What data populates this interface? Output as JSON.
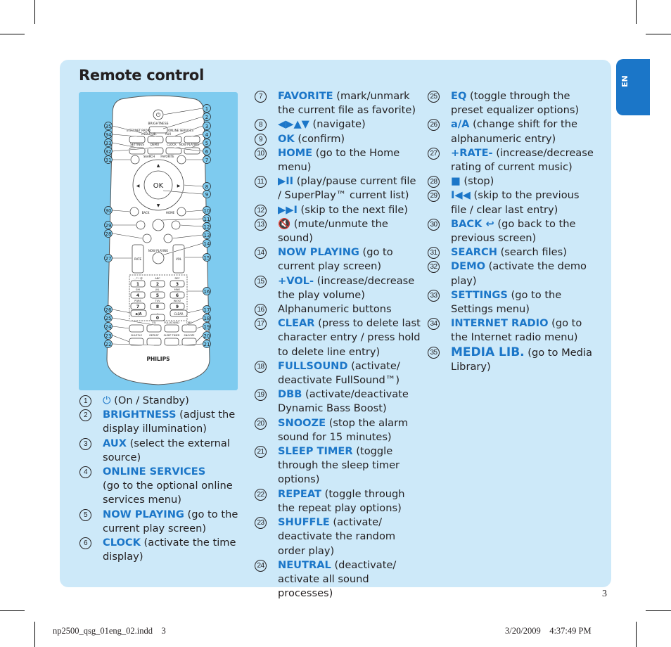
{
  "page": {
    "title": "Remote control",
    "language_tab": "EN",
    "page_number": "3",
    "slug_left": "np2500_qsg_01eng_02.indd    3",
    "slug_right": "3/20/2009    4:37:49 PM"
  },
  "colors": {
    "accent_blue": "#1b76c8",
    "panel_bg": "#cde9f9",
    "remote_bg": "#7ecbef"
  },
  "remote": {
    "brand": "PHILIPS",
    "ok_label": "OK",
    "button_labels": {
      "brightness": "BRIGHTNESS",
      "internet_radio": "INTERNET RADIO",
      "media_lib": "MEDIA LIB.",
      "aux": "AUX",
      "online_services": "ONLINE SERVICES",
      "settings": "SETTINGS",
      "demo": "DEMO",
      "clock": "CLOCK",
      "now_playing": "NOW PLAYING",
      "search": "SEARCH",
      "favorite": "FAVORITE",
      "back": "BACK",
      "home": "HOME",
      "rate": "RATE",
      "vol": "VOL",
      "now_playing_center": "NOW PLAYING",
      "a_a": "a/A",
      "clear": "CLEAR",
      "eq": "EQ",
      "fullsound": "FULLSOUND",
      "dbb": "DBB",
      "shuffle": "SHUFFLE",
      "repeat": "REPEAT",
      "sleep_timer": "SLEEP TIMER",
      "snooze": "SNOOZE",
      "neutral": "NEUTRAL"
    },
    "keypad": [
      {
        "digit": "1",
        "letters": ". , ? ! @"
      },
      {
        "digit": "2",
        "letters": "ABC"
      },
      {
        "digit": "3",
        "letters": "DEF"
      },
      {
        "digit": "4",
        "letters": "GHI"
      },
      {
        "digit": "5",
        "letters": "JKL"
      },
      {
        "digit": "6",
        "letters": "MNO"
      },
      {
        "digit": "7",
        "letters": "PQRS"
      },
      {
        "digit": "8",
        "letters": "TUV"
      },
      {
        "digit": "9",
        "letters": "WXYZ"
      },
      {
        "digit": "0",
        "letters": "_"
      }
    ],
    "callouts_right": [
      "1",
      "2",
      "3",
      "4",
      "5",
      "6",
      "7",
      "8",
      "9",
      "10",
      "11",
      "12",
      "13",
      "14",
      "15",
      "16",
      "17",
      "18",
      "19",
      "20",
      "21"
    ],
    "callouts_left": [
      "35",
      "34",
      "33",
      "32",
      "31",
      "30",
      "29",
      "28",
      "27",
      "26",
      "25",
      "24",
      "23",
      "22"
    ]
  },
  "legend": {
    "column1": [
      {
        "num": "1",
        "icon": "⏻",
        "key": "",
        "desc": " (On / Standby)"
      },
      {
        "num": "2",
        "key": "BRIGHTNESS",
        "desc": " (adjust the display illumination)"
      },
      {
        "num": "3",
        "key": "AUX",
        "desc": " (select the external source)"
      },
      {
        "num": "4",
        "key": "ONLINE SERVICES",
        "desc": "(go to the optional online services menu)"
      },
      {
        "num": "5",
        "key": "NOW PLAYING",
        "desc": " (go to the current play screen)"
      },
      {
        "num": "6",
        "key": "CLOCK",
        "desc": " (activate the time display)"
      }
    ],
    "column2": [
      {
        "num": "7",
        "key": "FAVORITE",
        "desc": " (mark/unmark the current file as favorite)"
      },
      {
        "num": "8",
        "key": "◀▶▲▼",
        "desc": " (navigate)"
      },
      {
        "num": "9",
        "key": "OK",
        "desc": " (confirm)"
      },
      {
        "num": "10",
        "key": "HOME",
        "desc": " (go to the Home menu)"
      },
      {
        "num": "11",
        "key": "▶II",
        "desc": " (play/pause current file / SuperPlay™ current list)"
      },
      {
        "num": "12",
        "key": "▶▶I",
        "desc": " (skip to the next file)"
      },
      {
        "num": "13",
        "key": "🔇",
        "desc": " (mute/unmute the sound)"
      },
      {
        "num": "14",
        "key": "NOW PLAYING",
        "desc": " (go to current play screen)"
      },
      {
        "num": "15",
        "key": "+VOL-",
        "desc": " (increase/decrease the play volume)"
      },
      {
        "num": "16",
        "key": "",
        "desc": "Alphanumeric buttons"
      },
      {
        "num": "17",
        "key": "CLEAR",
        "desc": " (press to delete last character entry / press hold to delete line entry)"
      },
      {
        "num": "18",
        "key": "FULLSOUND",
        "desc": " (activate/ deactivate FullSound™)"
      },
      {
        "num": "19",
        "key": "DBB",
        "desc": " (activate/deactivate Dynamic Bass Boost)"
      },
      {
        "num": "20",
        "key": "SNOOZE",
        "desc": " (stop the alarm sound for 15 minutes)"
      },
      {
        "num": "21",
        "key": "SLEEP TIMER",
        "desc": " (toggle through the sleep timer options)"
      },
      {
        "num": "22",
        "key": "REPEAT",
        "desc": " (toggle through the repeat play options)"
      },
      {
        "num": "23",
        "key": "SHUFFLE",
        "desc": " (activate/ deactivate the random order play)"
      },
      {
        "num": "24",
        "key": "NEUTRAL",
        "desc": " (deactivate/ activate all sound processes)"
      }
    ],
    "column3": [
      {
        "num": "25",
        "key": "EQ",
        "desc": " (toggle through the preset equalizer options)"
      },
      {
        "num": "26",
        "key": "a/A",
        "desc": " (change shift for the alphanumeric entry)"
      },
      {
        "num": "27",
        "key": "+RATE-",
        "desc": " (increase/decrease rating of current music)"
      },
      {
        "num": "28",
        "key": "■",
        "desc": " (stop)"
      },
      {
        "num": "29",
        "key": "I◀◀",
        "desc": " (skip to the previous file / clear last entry)"
      },
      {
        "num": "30",
        "key": "BACK ↩",
        "desc": " (go back to the previous screen)"
      },
      {
        "num": "31",
        "key": "SEARCH",
        "desc": " (search files)"
      },
      {
        "num": "32",
        "key": "DEMO",
        "desc": " (activate the demo play)"
      },
      {
        "num": "33",
        "key": "SETTINGS",
        "desc": " (go to the Settings menu)"
      },
      {
        "num": "34",
        "key": "INTERNET RADIO",
        "desc": " (go to the Internet radio menu)"
      },
      {
        "num": "35",
        "key": "MEDIA LIB.",
        "desc": " (go to Media Library)",
        "big": true
      }
    ]
  }
}
